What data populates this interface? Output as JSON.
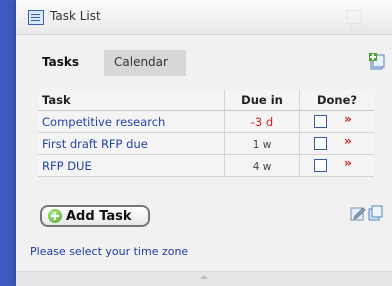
{
  "widget": {
    "title": "Task List",
    "edit_label": "Edit"
  },
  "tabs": [
    {
      "label": "Tasks",
      "active": true
    },
    {
      "label": "Calendar",
      "active": false
    }
  ],
  "table": {
    "headers": {
      "task": "Task",
      "due": "Due in",
      "done": "Done?"
    },
    "rows": [
      {
        "task": "Competitive research",
        "due": "-3 d",
        "overdue": true,
        "done": false
      },
      {
        "task": "First draft RFP due",
        "due": "1 w",
        "overdue": false,
        "done": false
      },
      {
        "task": "RFP DUE",
        "due": "4 w",
        "overdue": false,
        "done": false
      }
    ],
    "delete_glyph": "»"
  },
  "actions": {
    "add_task_label": "Add Task"
  },
  "footer": {
    "timezone_link": "Please select your time zone"
  },
  "colors": {
    "background": "#3d5cc2",
    "link": "#2342a8",
    "overdue": "#d42020",
    "add_icon": "#4ea32b"
  },
  "icons": [
    "app-list-icon",
    "add-tab-icon",
    "checkbox-icon",
    "delete-icon",
    "plus-circle-icon",
    "edit-icon",
    "copy-icon"
  ]
}
